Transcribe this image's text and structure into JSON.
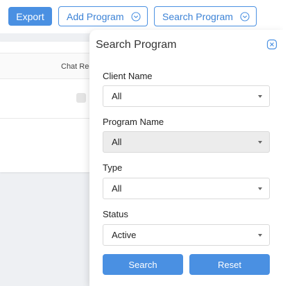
{
  "toolbar": {
    "export_label": "Export",
    "add_program_label": "Add Program",
    "search_program_label": "Search Program"
  },
  "table": {
    "columns": [
      "Chat Rec"
    ]
  },
  "search_panel": {
    "title": "Search Program",
    "fields": [
      {
        "label": "Client Name",
        "value": "All"
      },
      {
        "label": "Program Name",
        "value": "All"
      },
      {
        "label": "Type",
        "value": "All"
      },
      {
        "label": "Status",
        "value": "Active"
      }
    ],
    "search_label": "Search",
    "reset_label": "Reset"
  },
  "colors": {
    "accent": "#4a90e2",
    "disabled_bg": "#ececec"
  },
  "icons": [
    "chevron-down-circle-icon",
    "close-icon",
    "caret-down-icon"
  ]
}
